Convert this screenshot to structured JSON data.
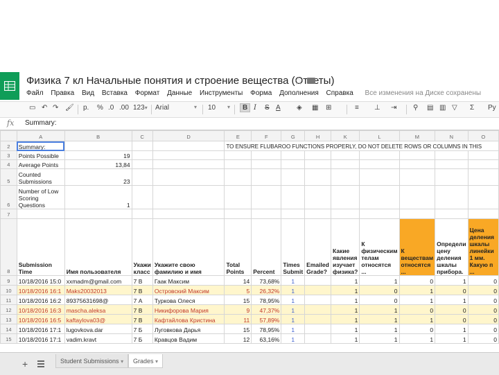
{
  "doc": {
    "title": "Физика 7 кл Начальные понятия и строение вещества (Ответы)",
    "star_icon": "star-icon",
    "folder_icon": "folder-icon"
  },
  "menu": [
    "Файл",
    "Правка",
    "Вид",
    "Вставка",
    "Формат",
    "Данные",
    "Инструменты",
    "Форма",
    "Дополнения",
    "Справка"
  ],
  "save_status": "Все изменения на Диске сохранены",
  "toolbar": {
    "currency": "р.",
    "percent": "%",
    "dec_less": ".0",
    "dec_more": ".00",
    "number_format": "123",
    "font": "Arial",
    "font_size": "10",
    "bold": "B",
    "italic": "I",
    "strike": "S",
    "text_color": "A",
    "sigma": "Σ",
    "input_tools": "Ру"
  },
  "formula_bar": {
    "fx": "fx",
    "value": "Summary:"
  },
  "columns": [
    "A",
    "B",
    "C",
    "D",
    "E",
    "F",
    "G",
    "H",
    "K",
    "L",
    "M",
    "N",
    "O"
  ],
  "rows": {
    "r2": {
      "num": "2",
      "a": "Summary:",
      "banner": "TO ENSURE FLUBAROO FUNCTIONS PROPERLY, DO NOT DELETE ROWS OR COLUMNS IN THIS"
    },
    "r3": {
      "num": "3",
      "a": "Points Possible",
      "b": "19"
    },
    "r4": {
      "num": "4",
      "a": "Average Points",
      "b": "13,84"
    },
    "r5": {
      "num": "5",
      "a": "Counted Submissions",
      "b": "23"
    },
    "r6": {
      "num": "6",
      "a": "Number of Low Scoring Questions",
      "b": "1"
    },
    "r7": {
      "num": "7"
    },
    "r8": {
      "num": "8",
      "a": "Submission Time",
      "b": "Имя пользователя",
      "c": "Укажи класс",
      "d": "Укажите свою фамилию и имя",
      "e": "Total Points",
      "f": "Percent",
      "g": "Times Submit",
      "h": "Emailed Grade?",
      "k": "Какие явления изучает физика?",
      "l": "К физическим телам относятся ...",
      "m": "К веществам относятся ...",
      "n": "Определи цену деления шкалы прибора.",
      "o": "Цена деления шкалы линейки 1 мм. Какую п ..."
    }
  },
  "data_rows": [
    {
      "num": "9",
      "time": "10/18/2016 15:0",
      "user": "xxmadm@gmail.com",
      "cls": "7 В",
      "name": "Гаак Максим",
      "pts": "14",
      "pct": "73,68%",
      "times": "1",
      "k": "1",
      "l": "1",
      "m": "0",
      "n": "1",
      "o": "0",
      "yellow": false
    },
    {
      "num": "10",
      "time": "10/18/2016 16:1",
      "user": "Maks20032013",
      "cls": "7 В",
      "name": "Островский Максим",
      "pts": "5",
      "pct": "26,32%",
      "times": "1",
      "k": "1",
      "l": "0",
      "m": "1",
      "n": "0",
      "o": "0",
      "yellow": true
    },
    {
      "num": "11",
      "time": "10/18/2016 16:2",
      "user": "89375631698@",
      "cls": "7 А",
      "name": "Туркова Олеся",
      "pts": "15",
      "pct": "78,95%",
      "times": "1",
      "k": "1",
      "l": "0",
      "m": "1",
      "n": "1",
      "o": "0",
      "yellow": false
    },
    {
      "num": "12",
      "time": "10/18/2016 16:3",
      "user": "mascha.aleksa",
      "cls": "7 В",
      "name": "Никифорова Мария",
      "pts": "9",
      "pct": "47,37%",
      "times": "1",
      "k": "1",
      "l": "1",
      "m": "0",
      "n": "0",
      "o": "0",
      "yellow": true
    },
    {
      "num": "13",
      "time": "10/18/2016 16:5",
      "user": "kaftaylova03@",
      "cls": "7 В",
      "name": "Кафтайлова Кристина",
      "pts": "11",
      "pct": "57,89%",
      "times": "1",
      "k": "1",
      "l": "1",
      "m": "1",
      "n": "0",
      "o": "0",
      "yellow": true
    },
    {
      "num": "14",
      "time": "10/18/2016 17:1",
      "user": "lugovkova.dar",
      "cls": "7 Б",
      "name": "Луговкова Дарья",
      "pts": "15",
      "pct": "78,95%",
      "times": "1",
      "k": "1",
      "l": "1",
      "m": "0",
      "n": "1",
      "o": "0",
      "yellow": false
    },
    {
      "num": "15",
      "time": "10/18/2016 17:1",
      "user": "vadim.kravt",
      "cls": "7 Б",
      "name": "Кравцов Вадим",
      "pts": "12",
      "pct": "63,16%",
      "times": "1",
      "k": "1",
      "l": "1",
      "m": "1",
      "n": "1",
      "o": "0",
      "yellow": false
    }
  ],
  "sheets": [
    "Student Submissions",
    "Grades"
  ],
  "colors": {
    "brand": "#0f9d58",
    "highlight": "#f9a825",
    "low_score_row": "#fff6cc",
    "low_score_text": "#c0392b"
  }
}
